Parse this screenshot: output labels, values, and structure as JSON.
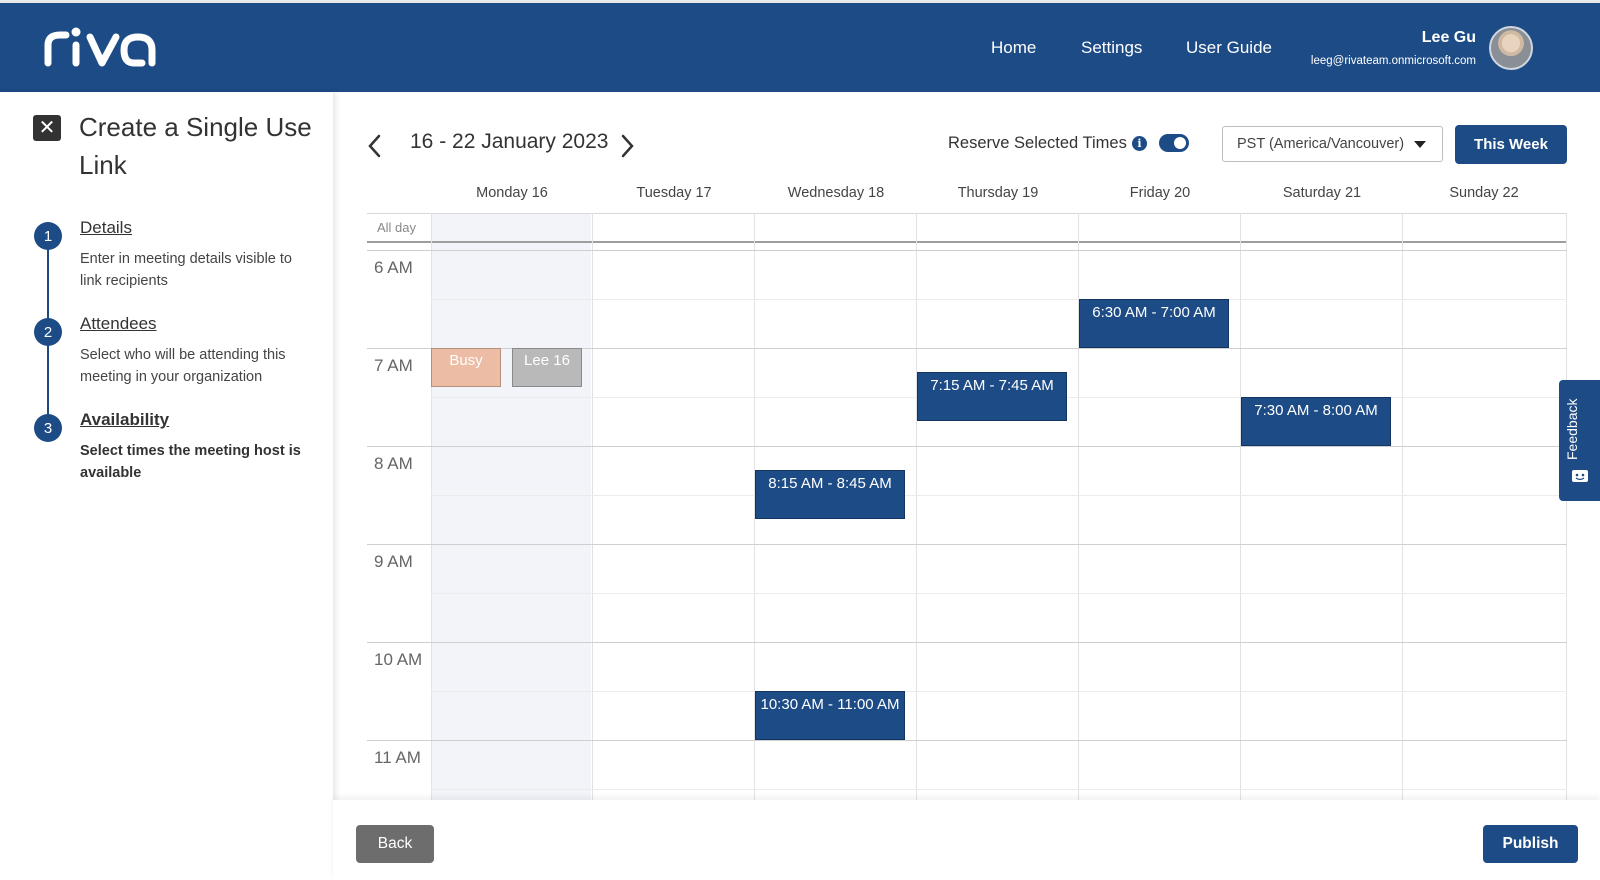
{
  "app": {
    "logo_text": "riva",
    "nav": [
      {
        "label": "Home"
      },
      {
        "label": "Settings"
      },
      {
        "label": "User Guide"
      }
    ],
    "user": {
      "name": "Lee Gu",
      "email": "leeg@rivateam.onmicrosoft.com"
    },
    "brand_color": "#1d4b86"
  },
  "sidebar": {
    "title": "Create a Single Use Link",
    "steps": [
      {
        "number": "1",
        "title": "Details",
        "description": "Enter in meeting details visible to link recipients"
      },
      {
        "number": "2",
        "title": "Attendees",
        "description": "Select who will be attending this meeting in your organization"
      },
      {
        "number": "3",
        "title": "Availability",
        "description": "Select times the meeting host is available"
      }
    ]
  },
  "toolbar": {
    "week_range": "16 - 22 January 2023",
    "reserve_label": "Reserve Selected Times",
    "reserve_enabled": true,
    "timezone": "PST (America/Vancouver)",
    "this_week_label": "This Week"
  },
  "calendar": {
    "allday_label": "All day",
    "days": [
      "Monday 16",
      "Tuesday 17",
      "Wednesday 18",
      "Thursday 19",
      "Friday 20",
      "Saturday 21",
      "Sunday 22"
    ],
    "hours": [
      "6 AM",
      "7 AM",
      "8 AM",
      "9 AM",
      "10 AM",
      "11 AM"
    ],
    "events": [
      {
        "day": "Monday 16",
        "label": "Busy",
        "kind": "busy"
      },
      {
        "day": "Monday 16",
        "label": "Lee 16",
        "kind": "other"
      }
    ],
    "selected_slots": [
      {
        "day": "Friday 20",
        "label": "6:30 AM - 7:00 AM"
      },
      {
        "day": "Thursday 19",
        "label": "7:15 AM - 7:45 AM"
      },
      {
        "day": "Saturday 21",
        "label": "7:30 AM - 8:00 AM"
      },
      {
        "day": "Wednesday 18",
        "label": "8:15 AM - 8:45 AM"
      },
      {
        "day": "Wednesday 18",
        "label": "10:30 AM - 11:00 AM"
      }
    ]
  },
  "feedback": {
    "label": "Feedback"
  },
  "footer": {
    "back_label": "Back",
    "publish_label": "Publish"
  }
}
